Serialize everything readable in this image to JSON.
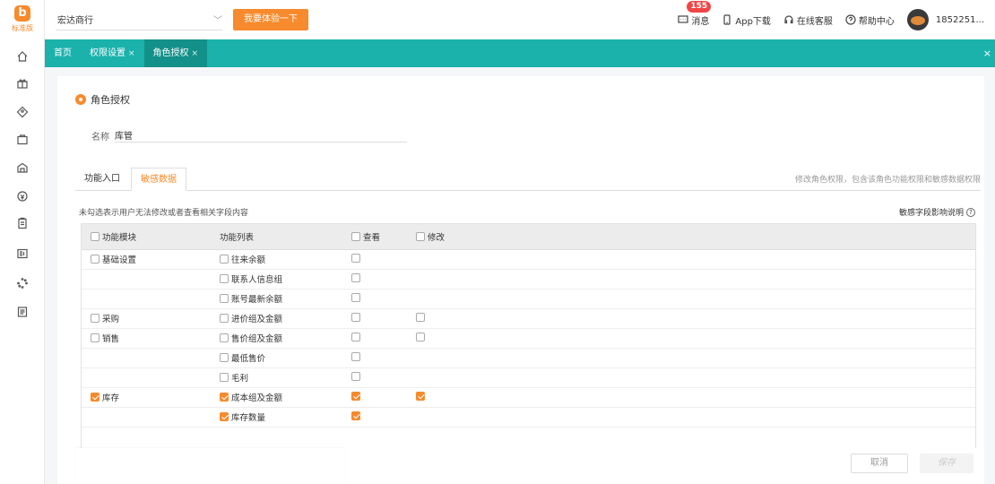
{
  "app": {
    "logo_text": "标准版"
  },
  "topbar": {
    "store": "宏达商行",
    "try_button": "我要体验一下",
    "messages_label": "消息",
    "messages_count": "155",
    "app_download": "App下载",
    "online_service": "在线客服",
    "help_center": "帮助中心",
    "user": "1852251..."
  },
  "tabs": [
    {
      "label": "首页",
      "closable": false
    },
    {
      "label": "权限设置",
      "closable": true
    },
    {
      "label": "角色授权",
      "closable": true,
      "active": true
    }
  ],
  "section_title": "角色授权",
  "name_field": {
    "label": "名称",
    "value": "库管"
  },
  "subtabs": [
    {
      "label": "功能入口"
    },
    {
      "label": "敏感数据",
      "active": true
    }
  ],
  "subtabs_note": "修改角色权限，包含该角色功能权限和敏感数据权限",
  "hint": "未勾选表示用户无法修改或者查看相关字段内容",
  "impact_link": "敏感字段影响说明",
  "table": {
    "headers": [
      "功能模块",
      "功能列表",
      "查看",
      "修改"
    ],
    "rows": [
      {
        "module": "基础设置",
        "module_checked": false,
        "func": "往来余额",
        "func_checked": false,
        "view": false,
        "edit": null
      },
      {
        "module": "",
        "module_checked": null,
        "func": "联系人信息组",
        "func_checked": false,
        "view": false,
        "edit": null
      },
      {
        "module": "",
        "module_checked": null,
        "func": "账号最新余额",
        "func_checked": false,
        "view": false,
        "edit": null
      },
      {
        "module": "采购",
        "module_checked": false,
        "func": "进价组及金额",
        "func_checked": false,
        "view": false,
        "edit": false
      },
      {
        "module": "销售",
        "module_checked": false,
        "func": "售价组及金额",
        "func_checked": false,
        "view": false,
        "edit": false
      },
      {
        "module": "",
        "module_checked": null,
        "func": "最低售价",
        "func_checked": false,
        "view": false,
        "edit": null
      },
      {
        "module": "",
        "module_checked": null,
        "func": "毛利",
        "func_checked": false,
        "view": false,
        "edit": null
      },
      {
        "module": "库存",
        "module_checked": true,
        "func": "成本组及金额",
        "func_checked": true,
        "view": true,
        "edit": true
      },
      {
        "module": "",
        "module_checked": null,
        "func": "库存数量",
        "func_checked": true,
        "view": true,
        "edit": null
      }
    ]
  },
  "footer": {
    "cancel": "取消",
    "save": "保存"
  },
  "colors": {
    "accent": "#f78a2c",
    "teal": "#1ab2ab",
    "badge": "#f04646"
  }
}
